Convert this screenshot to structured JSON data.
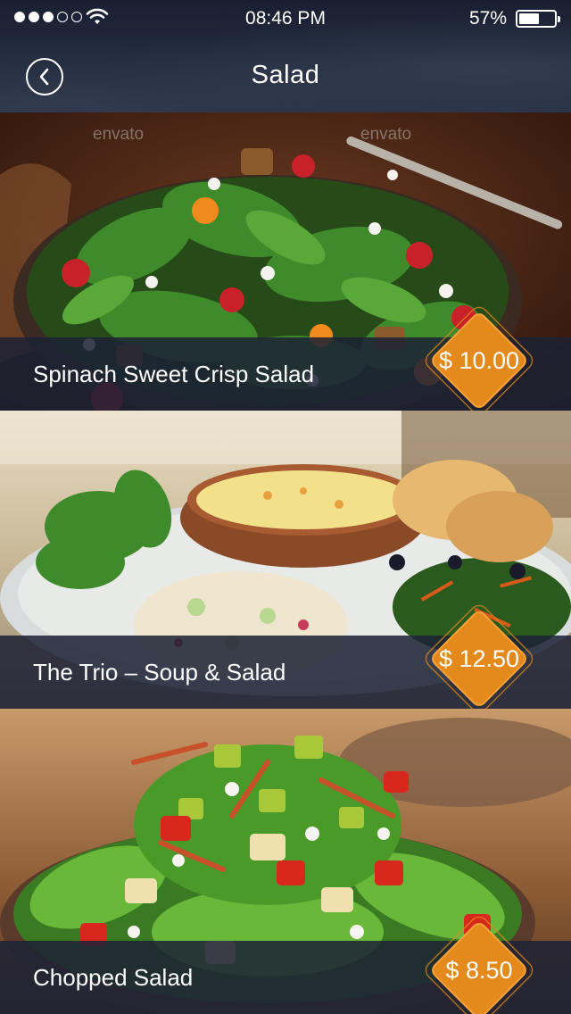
{
  "status": {
    "time": "08:46 PM",
    "battery": "57%",
    "battery_level": 0.57,
    "signal_bars_filled": 3,
    "signal_bars_total": 5
  },
  "nav": {
    "title": "Salad",
    "back_icon": "chevron-left-icon"
  },
  "colors": {
    "accent": "#e48a1c",
    "caption_bg": "#1c2234"
  },
  "watermark": "envato",
  "items": [
    {
      "name": "Spinach Sweet Crisp Salad",
      "price": "$ 10.00"
    },
    {
      "name": "The Trio – Soup & Salad",
      "price": "$ 12.50"
    },
    {
      "name": "Chopped Salad",
      "price": "$ 8.50"
    }
  ]
}
